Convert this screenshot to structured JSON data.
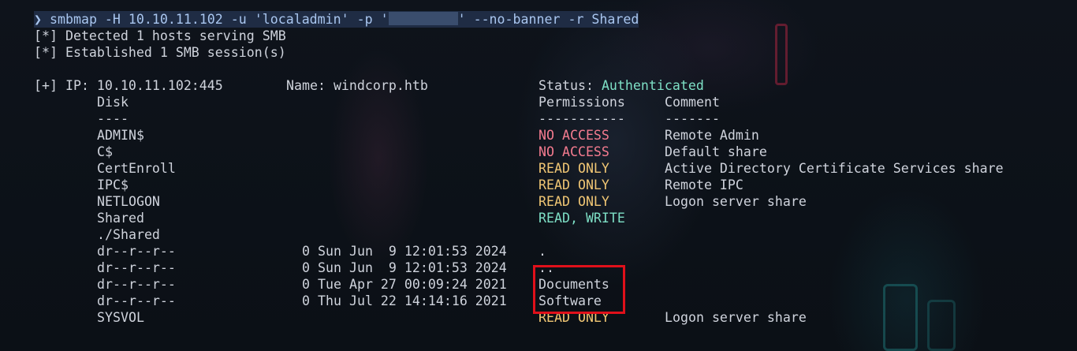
{
  "terminal": {
    "prompt_symbol": "❯",
    "command_part1": "smbmap -H 10.10.11.102 -u 'localadmin' -p '",
    "command_part2": "' --no-banner -r Shared",
    "lines": {
      "detected": "[*] Detected 1 hosts serving SMB",
      "established": "[*] Established 1 SMB session(s)",
      "ip_label": "[+] IP: 10.10.11.102:445",
      "name_label": "Name: windcorp.htb",
      "status_label": "Status: ",
      "status_value": "Authenticated"
    },
    "header": {
      "disk": "Disk",
      "permissions": "Permissions",
      "comment": "Comment",
      "disk_rule": "----",
      "perm_rule": "-----------",
      "comment_rule": "-------"
    },
    "shares": [
      {
        "name": "ADMIN$",
        "perm": "NO ACCESS",
        "comment": "Remote Admin"
      },
      {
        "name": "C$",
        "perm": "NO ACCESS",
        "comment": "Default share"
      },
      {
        "name": "CertEnroll",
        "perm": "READ ONLY",
        "comment": "Active Directory Certificate Services share"
      },
      {
        "name": "IPC$",
        "perm": "READ ONLY",
        "comment": "Remote IPC"
      },
      {
        "name": "NETLOGON",
        "perm": "READ ONLY",
        "comment": "Logon server share"
      },
      {
        "name": "Shared",
        "perm": "READ, WRITE",
        "comment": ""
      }
    ],
    "listing_path": "./Shared",
    "listing": [
      {
        "mode": "dr--r--r--",
        "size": "0",
        "date": "Sun Jun  9 12:01:53 2024",
        "name": "."
      },
      {
        "mode": "dr--r--r--",
        "size": "0",
        "date": "Sun Jun  9 12:01:53 2024",
        "name": ".."
      },
      {
        "mode": "dr--r--r--",
        "size": "0",
        "date": "Tue Apr 27 00:09:24 2021",
        "name": "Documents"
      },
      {
        "mode": "dr--r--r--",
        "size": "0",
        "date": "Thu Jul 22 14:14:16 2021",
        "name": "Software"
      }
    ],
    "last_share": {
      "name": "SYSVOL",
      "perm": "READ ONLY",
      "comment": "Logon server share"
    }
  },
  "colors": {
    "no_access": "#f47b8f",
    "read_only": "#f0c674",
    "read_write": "#7ee0c6",
    "highlight_box": "#e0101a"
  }
}
